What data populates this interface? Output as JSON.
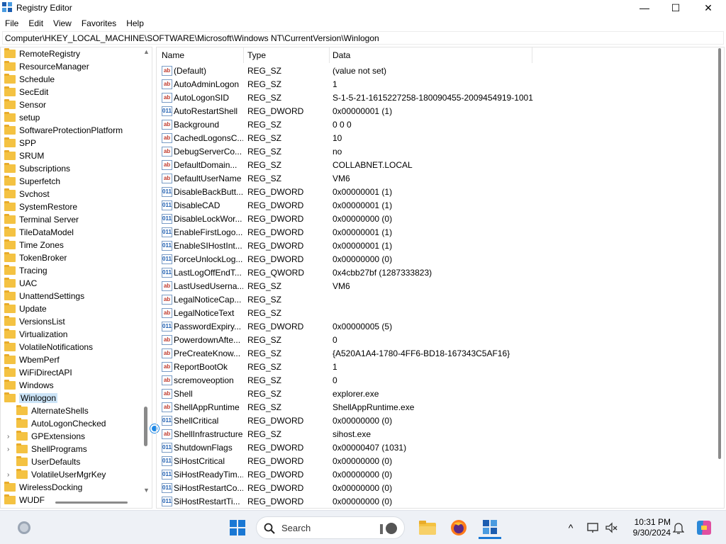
{
  "window": {
    "title": "Registry Editor",
    "minimize": "—",
    "maximize": "☐",
    "close": "✕"
  },
  "menu": [
    "File",
    "Edit",
    "View",
    "Favorites",
    "Help"
  ],
  "address": "Computer\\HKEY_LOCAL_MACHINE\\SOFTWARE\\Microsoft\\Windows NT\\CurrentVersion\\Winlogon",
  "tree": {
    "items": [
      {
        "label": "RemoteRegistry",
        "level": 0
      },
      {
        "label": "ResourceManager",
        "level": 0
      },
      {
        "label": "Schedule",
        "level": 0
      },
      {
        "label": "SecEdit",
        "level": 0
      },
      {
        "label": "Sensor",
        "level": 0
      },
      {
        "label": "setup",
        "level": 0
      },
      {
        "label": "SoftwareProtectionPlatform",
        "level": 0
      },
      {
        "label": "SPP",
        "level": 0
      },
      {
        "label": "SRUM",
        "level": 0
      },
      {
        "label": "Subscriptions",
        "level": 0
      },
      {
        "label": "Superfetch",
        "level": 0
      },
      {
        "label": "Svchost",
        "level": 0
      },
      {
        "label": "SystemRestore",
        "level": 0
      },
      {
        "label": "Terminal Server",
        "level": 0
      },
      {
        "label": "TileDataModel",
        "level": 0
      },
      {
        "label": "Time Zones",
        "level": 0
      },
      {
        "label": "TokenBroker",
        "level": 0
      },
      {
        "label": "Tracing",
        "level": 0
      },
      {
        "label": "UAC",
        "level": 0
      },
      {
        "label": "UnattendSettings",
        "level": 0
      },
      {
        "label": "Update",
        "level": 0
      },
      {
        "label": "VersionsList",
        "level": 0
      },
      {
        "label": "Virtualization",
        "level": 0
      },
      {
        "label": "VolatileNotifications",
        "level": 0
      },
      {
        "label": "WbemPerf",
        "level": 0
      },
      {
        "label": "WiFiDirectAPI",
        "level": 0
      },
      {
        "label": "Windows",
        "level": 0
      },
      {
        "label": "Winlogon",
        "level": 0,
        "selected": true,
        "expanded": true
      },
      {
        "label": "AlternateShells",
        "level": 1
      },
      {
        "label": "AutoLogonChecked",
        "level": 1
      },
      {
        "label": "GPExtensions",
        "level": 1,
        "expander": "›"
      },
      {
        "label": "ShellPrograms",
        "level": 1,
        "expander": "›"
      },
      {
        "label": "UserDefaults",
        "level": 1
      },
      {
        "label": "VolatileUserMgrKey",
        "level": 1,
        "expander": "›"
      },
      {
        "label": "WirelessDocking",
        "level": 0
      },
      {
        "label": "WUDF",
        "level": 0
      }
    ]
  },
  "columns": {
    "name": "Name",
    "type": "Type",
    "data": "Data"
  },
  "values": [
    {
      "name": "(Default)",
      "type": "REG_SZ",
      "data": "(value not set)",
      "icon": "ab"
    },
    {
      "name": "AutoAdminLogon",
      "type": "REG_SZ",
      "data": "1",
      "icon": "ab"
    },
    {
      "name": "AutoLogonSID",
      "type": "REG_SZ",
      "data": "S-1-5-21-1615227258-180090455-2009454919-1001",
      "icon": "ab"
    },
    {
      "name": "AutoRestartShell",
      "type": "REG_DWORD",
      "data": "0x00000001 (1)",
      "icon": "bin"
    },
    {
      "name": "Background",
      "type": "REG_SZ",
      "data": "0 0 0",
      "icon": "ab"
    },
    {
      "name": "CachedLogonsC...",
      "type": "REG_SZ",
      "data": "10",
      "icon": "ab"
    },
    {
      "name": "DebugServerCo...",
      "type": "REG_SZ",
      "data": "no",
      "icon": "ab"
    },
    {
      "name": "DefaultDomain...",
      "type": "REG_SZ",
      "data": "COLLABNET.LOCAL",
      "icon": "ab"
    },
    {
      "name": "DefaultUserName",
      "type": "REG_SZ",
      "data": "VM6",
      "icon": "ab"
    },
    {
      "name": "DisableBackButt...",
      "type": "REG_DWORD",
      "data": "0x00000001 (1)",
      "icon": "bin"
    },
    {
      "name": "DisableCAD",
      "type": "REG_DWORD",
      "data": "0x00000001 (1)",
      "icon": "bin"
    },
    {
      "name": "DisableLockWor...",
      "type": "REG_DWORD",
      "data": "0x00000000 (0)",
      "icon": "bin"
    },
    {
      "name": "EnableFirstLogo...",
      "type": "REG_DWORD",
      "data": "0x00000001 (1)",
      "icon": "bin"
    },
    {
      "name": "EnableSIHostInt...",
      "type": "REG_DWORD",
      "data": "0x00000001 (1)",
      "icon": "bin"
    },
    {
      "name": "ForceUnlockLog...",
      "type": "REG_DWORD",
      "data": "0x00000000 (0)",
      "icon": "bin"
    },
    {
      "name": "LastLogOffEndT...",
      "type": "REG_QWORD",
      "data": "0x4cbb27bf (1287333823)",
      "icon": "bin"
    },
    {
      "name": "LastUsedUserna...",
      "type": "REG_SZ",
      "data": "VM6",
      "icon": "ab"
    },
    {
      "name": "LegalNoticeCap...",
      "type": "REG_SZ",
      "data": "",
      "icon": "ab"
    },
    {
      "name": "LegalNoticeText",
      "type": "REG_SZ",
      "data": "",
      "icon": "ab"
    },
    {
      "name": "PasswordExpiry...",
      "type": "REG_DWORD",
      "data": "0x00000005 (5)",
      "icon": "bin"
    },
    {
      "name": "PowerdownAfte...",
      "type": "REG_SZ",
      "data": "0",
      "icon": "ab"
    },
    {
      "name": "PreCreateKnow...",
      "type": "REG_SZ",
      "data": "{A520A1A4-1780-4FF6-BD18-167343C5AF16}",
      "icon": "ab"
    },
    {
      "name": "ReportBootOk",
      "type": "REG_SZ",
      "data": "1",
      "icon": "ab"
    },
    {
      "name": "scremoveoption",
      "type": "REG_SZ",
      "data": "0",
      "icon": "ab"
    },
    {
      "name": "Shell",
      "type": "REG_SZ",
      "data": "explorer.exe",
      "icon": "ab"
    },
    {
      "name": "ShellAppRuntime",
      "type": "REG_SZ",
      "data": "ShellAppRuntime.exe",
      "icon": "ab"
    },
    {
      "name": "ShellCritical",
      "type": "REG_DWORD",
      "data": "0x00000000 (0)",
      "icon": "bin"
    },
    {
      "name": "ShellInfrastructure",
      "type": "REG_SZ",
      "data": "sihost.exe",
      "icon": "ab"
    },
    {
      "name": "ShutdownFlags",
      "type": "REG_DWORD",
      "data": "0x00000407 (1031)",
      "icon": "bin"
    },
    {
      "name": "SiHostCritical",
      "type": "REG_DWORD",
      "data": "0x00000000 (0)",
      "icon": "bin"
    },
    {
      "name": "SiHostReadyTim...",
      "type": "REG_DWORD",
      "data": "0x00000000 (0)",
      "icon": "bin"
    },
    {
      "name": "SiHostRestartCo...",
      "type": "REG_DWORD",
      "data": "0x00000000 (0)",
      "icon": "bin"
    },
    {
      "name": "SiHostRestartTi...",
      "type": "REG_DWORD",
      "data": "0x00000000 (0)",
      "icon": "bin"
    }
  ],
  "taskbar": {
    "search_label": "Search",
    "time": "10:31 PM",
    "date": "9/30/2024",
    "chevron": "^"
  }
}
